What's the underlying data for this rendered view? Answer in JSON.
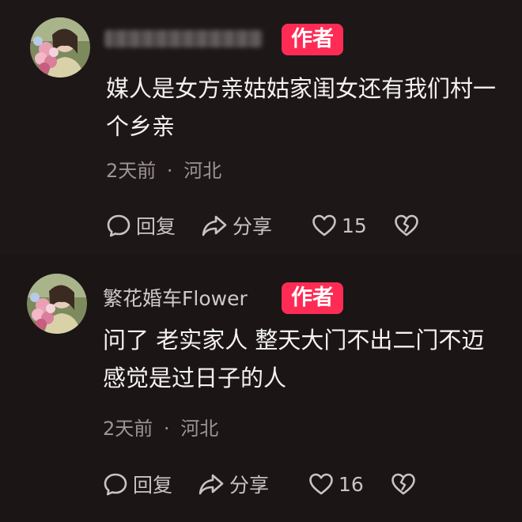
{
  "comments": [
    {
      "username": "",
      "badge": "作者",
      "text": "媒人是女方亲姑姑家闺女还有我们村一个乡亲",
      "time": "2天前",
      "separator": "·",
      "location": "河北",
      "reply_label": "回复",
      "share_label": "分享",
      "like_count": "15",
      "username_blurred": true
    },
    {
      "username": "繁花婚车Flower",
      "badge": "作者",
      "text": "问了 老实家人 整天大门不出二门不迈感觉是过日子的人",
      "time": "2天前",
      "separator": "·",
      "location": "河北",
      "reply_label": "回复",
      "share_label": "分享",
      "like_count": "16"
    }
  ],
  "colors": {
    "background": "#1c1617",
    "author_badge": "#fe2c55",
    "text": "#f4f2f2",
    "meta": "#9b9597"
  },
  "icons": [
    "avatar-photo",
    "reply-icon",
    "share-icon",
    "heart-icon",
    "broken-heart-icon"
  ]
}
